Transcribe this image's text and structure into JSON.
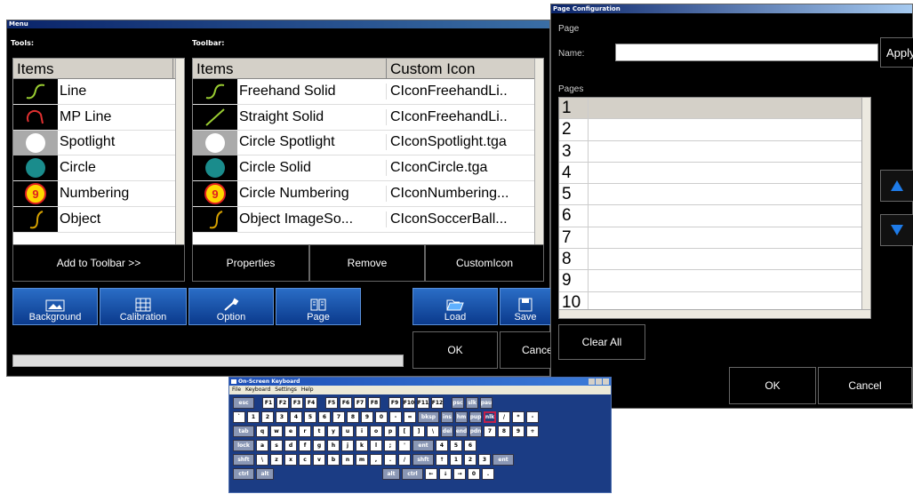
{
  "menu_window": {
    "title": "Menu",
    "tools_label": "Tools:",
    "toolbar_label": "Toolbar:",
    "tools_header": "Items",
    "tools": [
      {
        "label": "Line",
        "icon": "line-icon"
      },
      {
        "label": "MP Line",
        "icon": "mp-line-icon"
      },
      {
        "label": "Spotlight",
        "icon": "spotlight-icon"
      },
      {
        "label": "Circle",
        "icon": "circle-icon"
      },
      {
        "label": "Numbering",
        "icon": "numbering-icon"
      },
      {
        "label": "Object",
        "icon": "object-icon"
      }
    ],
    "toolbar_headers": [
      "Items",
      "Custom Icon"
    ],
    "toolbar_items": [
      {
        "label": "Freehand Solid",
        "icon_file": "CIconFreehandLi..",
        "icon": "freehand-icon"
      },
      {
        "label": "Straight Solid",
        "icon_file": "CIconFreehandLi..",
        "icon": "straight-line-icon"
      },
      {
        "label": "Circle Spotlight",
        "icon_file": "CIconSpotlight.tga",
        "icon": "spotlight-icon"
      },
      {
        "label": "Circle Solid",
        "icon_file": "CIconCircle.tga",
        "icon": "circle-icon"
      },
      {
        "label": "Circle Numbering",
        "icon_file": "CIconNumbering...",
        "icon": "numbering-icon"
      },
      {
        "label": "Object ImageSo...",
        "icon_file": "CIconSoccerBall...",
        "icon": "object-icon"
      }
    ],
    "add_button": "Add to Toolbar >>",
    "properties_button": "Properties",
    "remove_button": "Remove",
    "custom_icon_button": "CustomIcon",
    "background_button": "Background",
    "calibration_button": "Calibration",
    "option_button": "Option",
    "page_button": "Page",
    "load_button": "Load",
    "save_button": "Save",
    "ok_button": "OK",
    "cancel_button": "Cancel"
  },
  "page_config": {
    "title": "Page Configuration",
    "page_label": "Page",
    "name_label": "Name:",
    "name_value": "",
    "apply_button": "Apply",
    "pages_label": "Pages",
    "pages": [
      "1",
      "2",
      "3",
      "4",
      "5",
      "6",
      "7",
      "8",
      "9",
      "10"
    ],
    "clear_all_button": "Clear All",
    "ok_button": "OK",
    "cancel_button": "Cancel"
  },
  "keyboard": {
    "title": "On-Screen Keyboard",
    "menu": [
      "File",
      "Keyboard",
      "Settings",
      "Help"
    ],
    "rows": [
      [
        "esc",
        "F1",
        "F2",
        "F3",
        "F4",
        "F5",
        "F6",
        "F7",
        "F8",
        "F9",
        "F10",
        "F11",
        "F12",
        "psc",
        "slk",
        "pau"
      ],
      [
        "`",
        "1",
        "2",
        "3",
        "4",
        "5",
        "6",
        "7",
        "8",
        "9",
        "0",
        "-",
        "=",
        "bksp",
        "ins",
        "hm",
        "pup",
        "nlk",
        "/",
        "*",
        "-"
      ],
      [
        "tab",
        "q",
        "w",
        "e",
        "r",
        "t",
        "y",
        "u",
        "i",
        "o",
        "p",
        "[",
        "]",
        "\\",
        "del",
        "end",
        "pdn",
        "7",
        "8",
        "9",
        "+"
      ],
      [
        "lock",
        "a",
        "s",
        "d",
        "f",
        "g",
        "h",
        "j",
        "k",
        "l",
        ";",
        "'",
        "ent",
        "4",
        "5",
        "6"
      ],
      [
        "shft",
        "\\",
        "z",
        "x",
        "c",
        "v",
        "b",
        "n",
        "m",
        ",",
        ".",
        "/",
        "shft",
        "↑",
        "1",
        "2",
        "3",
        "ent"
      ],
      [
        "ctrl",
        "alt",
        "alt",
        "ctrl",
        "←",
        "↓",
        "→",
        "0",
        "."
      ]
    ]
  }
}
